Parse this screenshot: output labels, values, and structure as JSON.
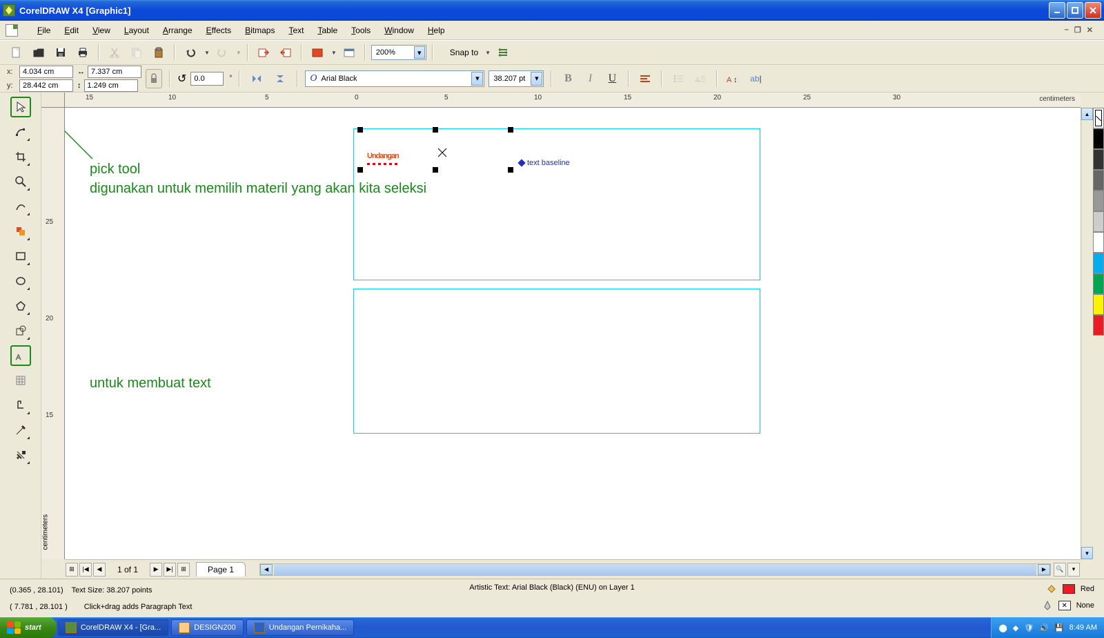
{
  "titlebar": {
    "app": "CorelDRAW X4",
    "doc": "[Graphic1]"
  },
  "menu": [
    "File",
    "Edit",
    "View",
    "Layout",
    "Arrange",
    "Effects",
    "Bitmaps",
    "Text",
    "Table",
    "Tools",
    "Window",
    "Help"
  ],
  "toolbar": {
    "zoom": "200%",
    "snap_label": "Snap to"
  },
  "propbar": {
    "x_label": "x:",
    "x": "4.034 cm",
    "y_label": "y:",
    "y": "28.442 cm",
    "w": "7.337 cm",
    "h": "1.249 cm",
    "rot": "0.0",
    "font": "Arial Black",
    "size": "38.207 pt"
  },
  "ruler": {
    "h_ticks": [
      "15",
      "10",
      "5",
      "0",
      "5",
      "10",
      "15",
      "20",
      "25",
      "30"
    ],
    "h_unit": "centimeters",
    "v_ticks": [
      "25",
      "20",
      "15"
    ],
    "v_unit": "centimeters"
  },
  "canvas": {
    "text": "Undangan",
    "baseline_hint": "text baseline"
  },
  "annotations": {
    "pick1": "pick tool",
    "pick2": "digunakan untuk memilih materil yang akan kita seleksi",
    "text1": "untuk membuat text"
  },
  "page_nav": {
    "counter": "1 of 1",
    "tab": "Page 1"
  },
  "status": {
    "coords": "(0.365 , 28.101)",
    "textsize": "Text Size: 38.207 points",
    "artistic": "Artistic Text: Arial Black (Black) (ENU) on Layer 1",
    "coords2": "( 7.781 , 28.101 )",
    "hint": "Click+drag adds Paragraph Text",
    "fill_label": "Red",
    "outline_label": "None"
  },
  "taskbar": {
    "start": "start",
    "items": [
      "CorelDRAW X4 - [Gra...",
      "DESIGN200",
      "Undangan  Pernikaha..."
    ],
    "clock": "8:49 AM"
  },
  "palette_right": [
    "#000000",
    "#404040",
    "#808080",
    "#c0c0c0",
    "#ffffff",
    "#00aeef",
    "#00a651",
    "#fff200",
    "#f7941d"
  ],
  "palette_bottom": [
    "#000000",
    "#112233",
    "#1a2a4a",
    "#203050",
    "#2a4a1a",
    "#3a5a2a",
    "#4a7a3a",
    "#6a9a4a",
    "#00502a",
    "#006838",
    "#009444",
    "#00a651",
    "#39b54a",
    "#8dc63f",
    "#d7df23",
    "#fff200",
    "#ffde00",
    "#ffc20e",
    "#f7941d",
    "#f26522",
    "#ed1c24",
    "#be1e2d",
    "#9e1f63",
    "#92278f",
    "#662d91",
    "#2e3192",
    "#1b1464",
    "#2b3990",
    "#0054a6",
    "#0072bc",
    "#00aeef",
    "#27aae1",
    "#00a79d",
    "#00a99d",
    "#1cbbb4",
    "#6dcff6",
    "#f49ac1",
    "#f06eaa",
    "#ec008c",
    "#ed145b",
    "#ee2a7b",
    "#ef4136",
    "#f15a29",
    "#f58220",
    "#f9a01b",
    "#fdb913",
    "#ffcb05",
    "#ffd400",
    "#fff568",
    "#fffbcc",
    "#d1d3d4",
    "#a7a9ac"
  ]
}
